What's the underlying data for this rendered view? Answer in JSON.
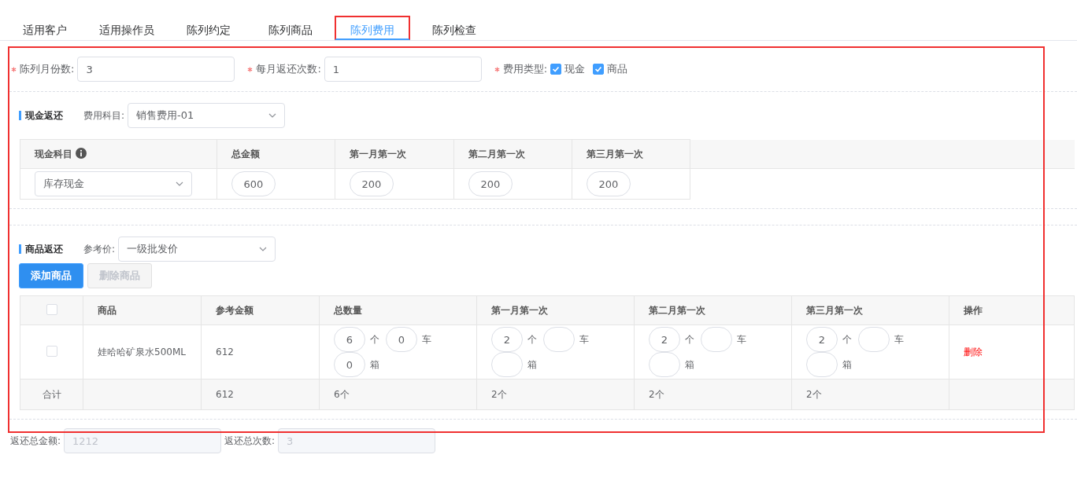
{
  "tabs": [
    {
      "label": "适用客户",
      "selected": false
    },
    {
      "label": "适用操作员",
      "selected": false
    },
    {
      "label": "陈列约定",
      "selected": false
    },
    {
      "label": "陈列商品",
      "selected": false
    },
    {
      "label": "陈列费用",
      "selected": true
    },
    {
      "label": "陈列检查",
      "selected": false
    }
  ],
  "form": {
    "fields": [
      {
        "label": "陈列月份数:",
        "required": true,
        "value": "3"
      },
      {
        "label": "每月返还次数:",
        "required": true,
        "value": "1"
      }
    ],
    "fee_type": {
      "label": "费用类型:",
      "required": true,
      "options": [
        {
          "label": "现金",
          "checked": true
        },
        {
          "label": "商品",
          "checked": true
        }
      ]
    }
  },
  "cash_section": {
    "title": "现金返还",
    "subject_label": "费用科目:",
    "subject_value": "销售费用-01",
    "table": {
      "columns": [
        {
          "label": "现金科目",
          "info": true
        },
        {
          "label": "总金额",
          "info": false
        },
        {
          "label": "第一月第一次",
          "info": false
        },
        {
          "label": "第二月第一次",
          "info": false
        },
        {
          "label": "第三月第一次",
          "info": false
        }
      ],
      "rows": [
        {
          "subject": "库存现金",
          "values": [
            "600",
            "200",
            "200",
            "200"
          ]
        }
      ]
    }
  },
  "goods_section": {
    "title": "商品返还",
    "price_label": "参考价:",
    "price_value": "一级批发价",
    "buttons": [
      {
        "label": "添加商品",
        "disabled": false
      },
      {
        "label": "删除商品",
        "disabled": true
      }
    ],
    "table": {
      "header_checked": false,
      "columns": [
        "商品",
        "参考金额",
        "总数量",
        "第一月第一次",
        "第二月第一次",
        "第三月第一次",
        "操作"
      ],
      "rows": [
        {
          "checked": false,
          "product": "娃哈哈矿泉水500ML",
          "amount": "612",
          "quantities": [
            [
              {
                "value": "6",
                "unit": "个"
              },
              {
                "value": "0",
                "unit": "车"
              },
              {
                "value": "0",
                "unit": "箱"
              }
            ],
            [
              {
                "value": "2",
                "unit": "个"
              },
              {
                "unit": "车"
              },
              {
                "unit": "箱"
              }
            ],
            [
              {
                "value": "2",
                "unit": "个"
              },
              {
                "unit": "车"
              },
              {
                "unit": "箱"
              }
            ],
            [
              {
                "value": "2",
                "unit": "个"
              },
              {
                "unit": "车"
              },
              {
                "unit": "箱"
              }
            ]
          ],
          "action": "删除"
        }
      ],
      "footer": [
        "合计",
        "612",
        "6个",
        "2个",
        "2个",
        "2个"
      ]
    }
  },
  "totals": [
    {
      "label": "返还总金额:",
      "value": "1212"
    },
    {
      "label": "返还总次数:",
      "value": "3"
    }
  ]
}
